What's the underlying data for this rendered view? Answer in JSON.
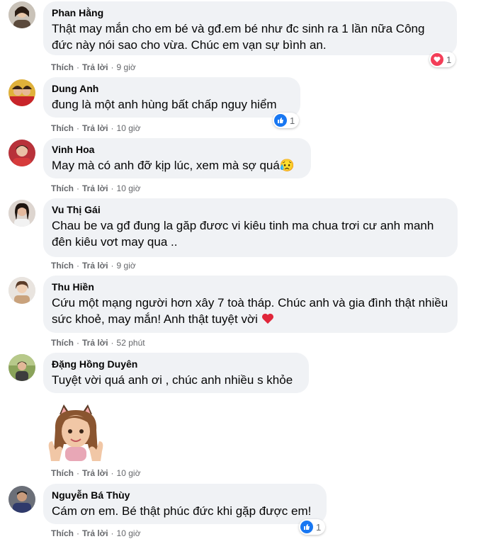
{
  "comments": [
    {
      "name": "Phan Hằng",
      "text": "Thật may mắn cho em bé và gđ.em bé như đc sinh ra 1 lần nữa Công đức này nói sao cho vừa. Chúc em vạn sự bình an.",
      "like": "Thích",
      "reply": "Trả lời",
      "time": "9 giờ",
      "reaction": "heart",
      "reaction_count": "1"
    },
    {
      "name": "Dung Anh",
      "text": "đung là một anh hùng bất chấp nguy hiểm",
      "like": "Thích",
      "reply": "Trả lời",
      "time": "10 giờ",
      "reaction": "like",
      "reaction_count": "1"
    },
    {
      "name": "Vinh Hoa",
      "text": "May mà có anh đỡ kịp lúc, xem mà sợ quá😥",
      "like": "Thích",
      "reply": "Trả lời",
      "time": "10 giờ"
    },
    {
      "name": "Vu Thị Gái",
      "text": "Chau be va gđ đung la găp đươc vi kiêu tinh ma chua trơi cư anh manh đên kiêu vơt may qua ..",
      "like": "Thích",
      "reply": "Trả lời",
      "time": "9 giờ"
    },
    {
      "name": "Thu Hiền",
      "text": "Cứu một mạng người hơn xây 7 toà tháp. Chúc anh và gia đình thật nhiều sức khoẻ, may mắn! Anh thật tuyệt vời",
      "like": "Thích",
      "reply": "Trả lời",
      "time": "52 phút"
    },
    {
      "name": "Đặng Hồng Duyên",
      "text": "Tuyệt vời quá anh ơi , chúc anh nhiều s khỏe",
      "like": "Thích",
      "reply": "Trả lời",
      "time": "10 giờ",
      "sticker": "cat-ear-girl-sticker"
    },
    {
      "name": "Nguyễn Bá Thùy",
      "text": "Cám ơn em. Bé thật phúc đức khi gặp được em!",
      "like": "Thích",
      "reply": "Trả lời",
      "time": "10 giờ",
      "reaction": "like",
      "reaction_count": "1"
    }
  ],
  "colors": {
    "bubble": "#f0f2f5",
    "meta": "#65676b",
    "like_blue": "#1877f2",
    "heart_red": "#f33e58"
  },
  "icons": {
    "heart": "heart-reaction-icon",
    "like": "like-reaction-icon"
  }
}
